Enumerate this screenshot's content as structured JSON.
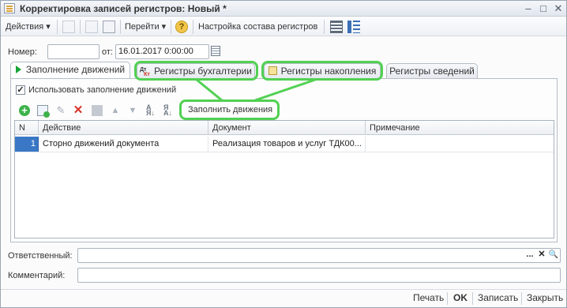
{
  "window": {
    "title": "Корректировка записей регистров: Новый *",
    "minimize": "–",
    "maximize": "□",
    "close": "✕"
  },
  "toolbar": {
    "actions_label": "Действия ▾",
    "goto_label": "Перейти ▾",
    "help_label": "?",
    "register_setup_label": "Настройка состава регистров"
  },
  "header": {
    "number_label": "Номер:",
    "number_value": "",
    "date_label": "от:",
    "date_value": "16.01.2017  0:00:00"
  },
  "tabs": [
    {
      "label": "Заполнение движений",
      "icon": "green-play-icon",
      "active": true
    },
    {
      "label": "Регистры бухгалтерии",
      "icon": "dt-kt-icon",
      "active": false
    },
    {
      "label": "Регистры накопления",
      "icon": "accumulation-register-icon",
      "active": false
    },
    {
      "label": "Регистры сведений",
      "icon": "",
      "active": false
    }
  ],
  "fill_panel": {
    "use_fill_label": "Использовать заполнение движений",
    "use_fill_checked": "✓",
    "fill_button_label": "Заполнить движения"
  },
  "table": {
    "columns": [
      "N",
      "Действие",
      "Документ",
      "Примечание"
    ],
    "rows": [
      {
        "n": "1",
        "action": "Сторно движений документа",
        "document": "Реализация товаров и услуг ТДК00...",
        "note": ""
      }
    ]
  },
  "footer_fields": {
    "responsible_label": "Ответственный:",
    "responsible_value": "",
    "select_button": "...",
    "clear_button": "✕",
    "search_button": "🔍",
    "comment_label": "Комментарий:",
    "comment_value": ""
  },
  "commands": {
    "print": "Печать",
    "ok": "OK",
    "save": "Записать",
    "close": "Закрыть"
  },
  "colors": {
    "highlight": "#52d053",
    "selected_row": "#3a78c6"
  }
}
